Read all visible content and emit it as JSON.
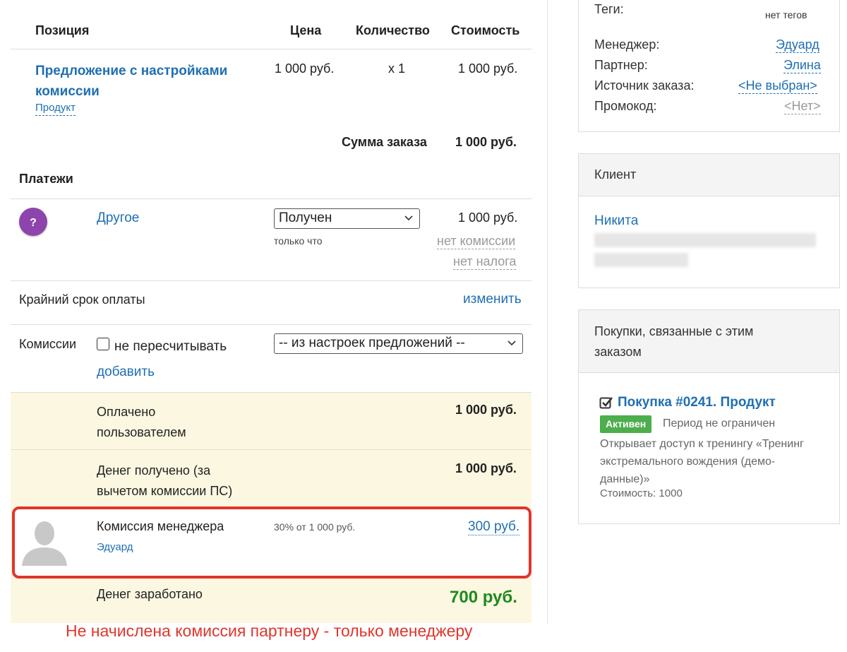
{
  "order": {
    "headers": {
      "position": "Позиция",
      "price": "Цена",
      "quantity": "Количество",
      "cost": "Стоимость"
    },
    "item": {
      "title_line1": "Предложение с настройками",
      "title_line2": "комиссии",
      "type_link": "Продукт",
      "price": "1 000 руб.",
      "quantity": "x 1",
      "cost": "1 000 руб."
    },
    "total_label": "Сумма заказа",
    "total_value": "1 000 руб."
  },
  "payments": {
    "heading": "Платежи",
    "method_icon": "question-icon",
    "method_name": "Другое",
    "status_selected": "Получен",
    "status_time": "только что",
    "amount": "1 000 руб.",
    "commission_link": "нет комиссии",
    "tax_link": "нет налога",
    "deadline_label": "Крайний срок оплаты",
    "deadline_change": "изменить",
    "commissions_label": "Комиссии",
    "no_recalc_label": "не пересчитывать",
    "commissions_select": "-- из настроек предложений --",
    "add_link": "добавить"
  },
  "summary": {
    "paid_line1": "Оплачено",
    "paid_line2": "пользователем",
    "paid_value": "1 000 руб.",
    "received_line1": "Денег получено (за",
    "received_line2": "вычетом комиссии ПС)",
    "received_value": "1 000 руб.",
    "manager_commission_label": "Комиссия менеджера",
    "manager_name": "Эдуард",
    "manager_commission_calc": "30% от 1 000 руб.",
    "manager_commission_value": "300 руб.",
    "earned_label": "Денег заработано",
    "earned_value": "700 руб."
  },
  "annotation": "Не начислена комиссия партнеру - только менеджеру",
  "sidebar": {
    "tags_label": "Теги:",
    "tags_value": "нет тегов",
    "manager_label": "Менеджер:",
    "manager_value": "Эдуард",
    "partner_label": "Партнер:",
    "partner_value": "Элина",
    "source_label": "Источник заказа:",
    "source_value": "<Не выбран>",
    "promo_label": "Промокод:",
    "promo_value": "<Нет>",
    "client_heading": "Клиент",
    "client_name": "Никита",
    "purchases_heading_line1": "Покупки, связанные с этим",
    "purchases_heading_line2": "заказом",
    "purchase_title": "Покупка #0241. Продукт",
    "purchase_status": "Активен",
    "purchase_period": "Период не ограничен",
    "purchase_desc_line1": "Открывает доступ к тренингу «Тренинг",
    "purchase_desc_line2": "экстремального вождения (демо-",
    "purchase_desc_line3": "данные)»",
    "purchase_cost": "Стоимость: 1000"
  },
  "colors": {
    "link": "#1f6fb2",
    "highlight_bg": "#fcf7e1",
    "annotation_red": "#e0362c",
    "earned_green": "#1e8a1e",
    "status_green": "#4cae4c",
    "question_purple": "#8e44ad"
  }
}
